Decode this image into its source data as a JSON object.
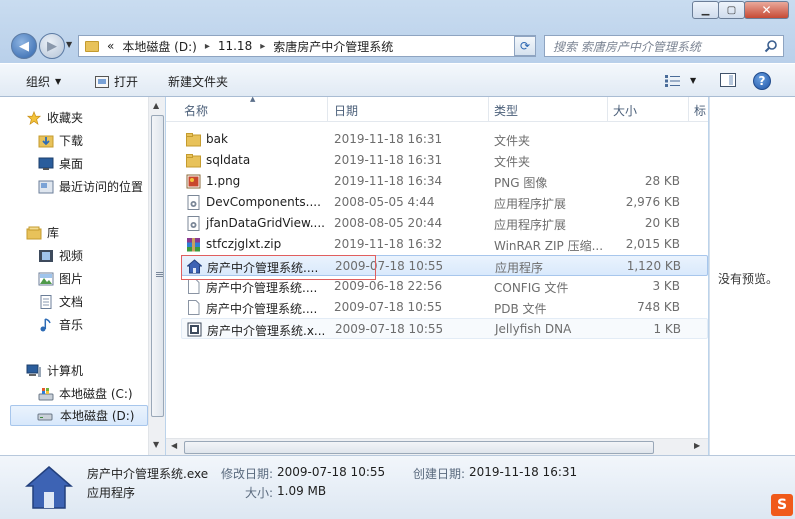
{
  "window": {
    "minimize": "▁",
    "maximize": "▢",
    "close": "✕"
  },
  "address": {
    "overflow": "«",
    "crumbs": [
      "本地磁盘 (D:)",
      "11.18",
      "索唐房产中介管理系统"
    ],
    "separator": "▸"
  },
  "search": {
    "placeholder": "搜索 索唐房产中介管理系统"
  },
  "toolbar": {
    "organize": "组织",
    "open": "打开",
    "new_folder": "新建文件夹",
    "help": "?"
  },
  "nav": {
    "favorites": "收藏夹",
    "downloads": "下载",
    "desktop": "桌面",
    "recent": "最近访问的位置",
    "libraries": "库",
    "videos": "视频",
    "pictures": "图片",
    "documents": "文档",
    "music": "音乐",
    "computer": "计算机",
    "drive_c": "本地磁盘 (C:)",
    "drive_d": "本地磁盘 (D:)"
  },
  "columns": {
    "name": "名称",
    "date": "日期",
    "type": "类型",
    "size": "大小",
    "tags": "标"
  },
  "files": [
    {
      "name": "bak",
      "date": "2019-11-18 16:31",
      "type": "文件夹",
      "size": "",
      "icon": "folder-icon"
    },
    {
      "name": "sqldata",
      "date": "2019-11-18 16:31",
      "type": "文件夹",
      "size": "",
      "icon": "folder-icon"
    },
    {
      "name": "1.png",
      "date": "2019-11-18 16:34",
      "type": "PNG 图像",
      "size": "28 KB",
      "icon": "image-file-icon"
    },
    {
      "name": "DevComponents....",
      "date": "2008-05-05 4:44",
      "type": "应用程序扩展",
      "size": "2,976 KB",
      "icon": "dll-file-icon"
    },
    {
      "name": "jfanDataGridView....",
      "date": "2008-08-05 20:44",
      "type": "应用程序扩展",
      "size": "20 KB",
      "icon": "dll-file-icon"
    },
    {
      "name": "stfczjglxt.zip",
      "date": "2019-11-18 16:32",
      "type": "WinRAR ZIP 压缩...",
      "size": "2,015 KB",
      "icon": "zip-file-icon"
    },
    {
      "name": "房产中介管理系统....",
      "date": "2009-07-18 10:55",
      "type": "应用程序",
      "size": "1,120 KB",
      "icon": "house-app-icon"
    },
    {
      "name": "房产中介管理系统....",
      "date": "2009-06-18 22:56",
      "type": "CONFIG 文件",
      "size": "3 KB",
      "icon": "blank-file-icon"
    },
    {
      "name": "房产中介管理系统....",
      "date": "2009-07-18 10:55",
      "type": "PDB 文件",
      "size": "748 KB",
      "icon": "blank-file-icon"
    },
    {
      "name": "房产中介管理系统.x...",
      "date": "2009-07-18 10:55",
      "type": "Jellyfish DNA",
      "size": "1 KB",
      "icon": "dna-file-icon"
    }
  ],
  "preview": {
    "text": "没有预览。"
  },
  "details": {
    "filename": "房产中介管理系统.exe",
    "type": "应用程序",
    "modified_label": "修改日期:",
    "modified": "2009-07-18 10:55",
    "created_label": "创建日期:",
    "created": "2019-11-18 16:31",
    "size_label": "大小:",
    "size": "1.09 MB"
  },
  "badge": "S"
}
